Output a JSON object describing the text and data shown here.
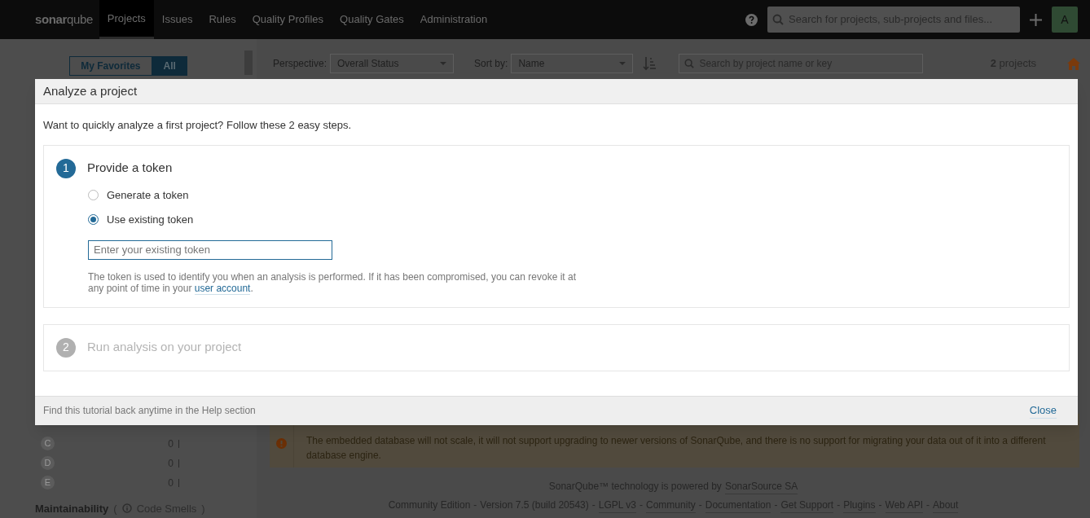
{
  "nav": {
    "logo_a": "sonar",
    "logo_b": "qube",
    "tabs": [
      {
        "label": "Projects",
        "selected": true
      },
      {
        "label": "Issues",
        "selected": false
      },
      {
        "label": "Rules",
        "selected": false
      },
      {
        "label": "Quality Profiles",
        "selected": false
      },
      {
        "label": "Quality Gates",
        "selected": false
      },
      {
        "label": "Administration",
        "selected": false
      }
    ],
    "search": {
      "placeholder": "Search for projects, sub-projects and files..."
    },
    "avatar": "A"
  },
  "sidebar": {
    "filter_toggle": [
      {
        "label": "My Favorites",
        "selected": false
      },
      {
        "label": "All",
        "selected": true
      }
    ],
    "ratings": [
      {
        "grade": "C",
        "count": "0"
      },
      {
        "grade": "D",
        "count": "0"
      },
      {
        "grade": "E",
        "count": "0"
      }
    ],
    "next_facet": {
      "title": "Maintainability",
      "paren_open": "(",
      "subtitle": "Code Smells",
      "paren_close": ")"
    }
  },
  "toolbar": {
    "perspective_label": "Perspective:",
    "perspective": "Overall Status",
    "sort_label": "Sort by:",
    "sort": "Name",
    "search": {
      "placeholder": "Search by project name or key"
    },
    "count": "**2** projects"
  },
  "warning": {
    "text": "The embedded database will not scale, it will not support upgrading to newer versions of SonarQube, and there is no support for migrating your data out of it into a different database engine."
  },
  "footer": {
    "powered_by": [
      {
        "text": "SonarQube™ technology is powered by",
        "link": false
      },
      {
        "text": "SonarSource SA",
        "link": true
      }
    ],
    "items": [
      {
        "text": "Community Edition",
        "link": false
      },
      {
        "text": "Version 7.5 (build 20543)",
        "link": false
      },
      {
        "text": "LGPL v3",
        "link": true
      },
      {
        "text": "Community",
        "link": true
      },
      {
        "text": "Documentation",
        "link": true
      },
      {
        "text": "Get Support",
        "link": true
      },
      {
        "text": "Plugins",
        "link": true
      },
      {
        "text": "Web API",
        "link": true
      },
      {
        "text": "About",
        "link": true
      }
    ],
    "separator": "-"
  },
  "modal": {
    "title": "Analyze a project",
    "intro": "Want to quickly analyze a first project? Follow these 2 easy steps.",
    "steps": [
      {
        "number": "1",
        "title": "Provide a token",
        "active": true,
        "options": [
          {
            "label": "Generate a token",
            "selected": false
          },
          {
            "label": "Use existing token",
            "selected": true
          }
        ],
        "token_field": {
          "placeholder": "Enter your existing token"
        },
        "help": {
          "before": "The token is used to identify you when an analysis is performed. If it has been compromised, you can revoke it at any point of time in your",
          "link": "user account",
          "after": "."
        }
      },
      {
        "number": "2",
        "title": "Run analysis on your project",
        "active": false
      }
    ],
    "footer_text": "Find this tutorial back anytime in the Help section",
    "close": "Close"
  }
}
